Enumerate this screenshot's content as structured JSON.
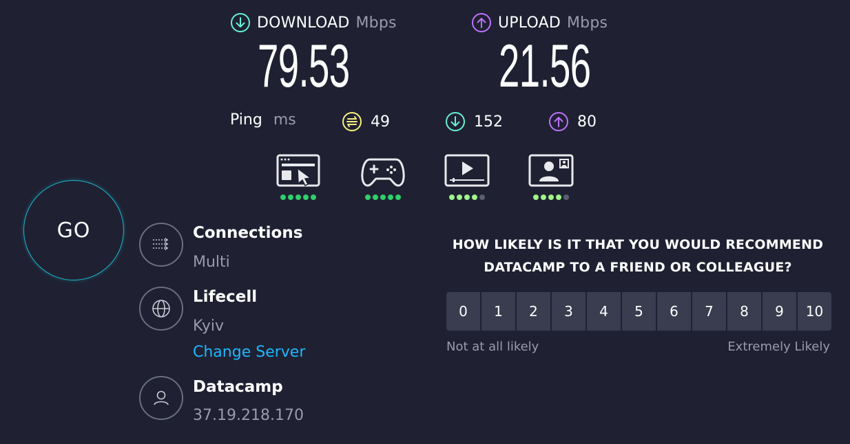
{
  "download": {
    "label": "DOWNLOAD",
    "unit": "Mbps",
    "value": "79.53",
    "color": "#68f1d3"
  },
  "upload": {
    "label": "UPLOAD",
    "unit": "Mbps",
    "value": "21.56",
    "color": "#bf71ff"
  },
  "ping": {
    "label": "Ping",
    "unit": "ms",
    "idle": "49",
    "download": "152",
    "upload": "80",
    "idle_color": "#fbf07f"
  },
  "usage": [
    {
      "icon": "web-browsing-icon",
      "rating": 5,
      "of": 5
    },
    {
      "icon": "gaming-icon",
      "rating": 5,
      "of": 5
    },
    {
      "icon": "video-streaming-icon",
      "rating": 4,
      "of": 5
    },
    {
      "icon": "video-chat-icon",
      "rating": 4,
      "of": 5
    }
  ],
  "go_label": "GO",
  "connections": {
    "title": "Connections",
    "value": "Multi"
  },
  "server": {
    "provider": "Lifecell",
    "city": "Kyiv",
    "change_label": "Change Server"
  },
  "client": {
    "provider": "Datacamp",
    "ip": "37.19.218.170"
  },
  "survey": {
    "question_line1": "HOW LIKELY IS IT THAT YOU WOULD RECOMMEND",
    "question_line2": "DATACAMP TO A FRIEND OR COLLEAGUE?",
    "scale": [
      "0",
      "1",
      "2",
      "3",
      "4",
      "5",
      "6",
      "7",
      "8",
      "9",
      "10"
    ],
    "low_label": "Not at all likely",
    "high_label": "Extremely Likely"
  }
}
